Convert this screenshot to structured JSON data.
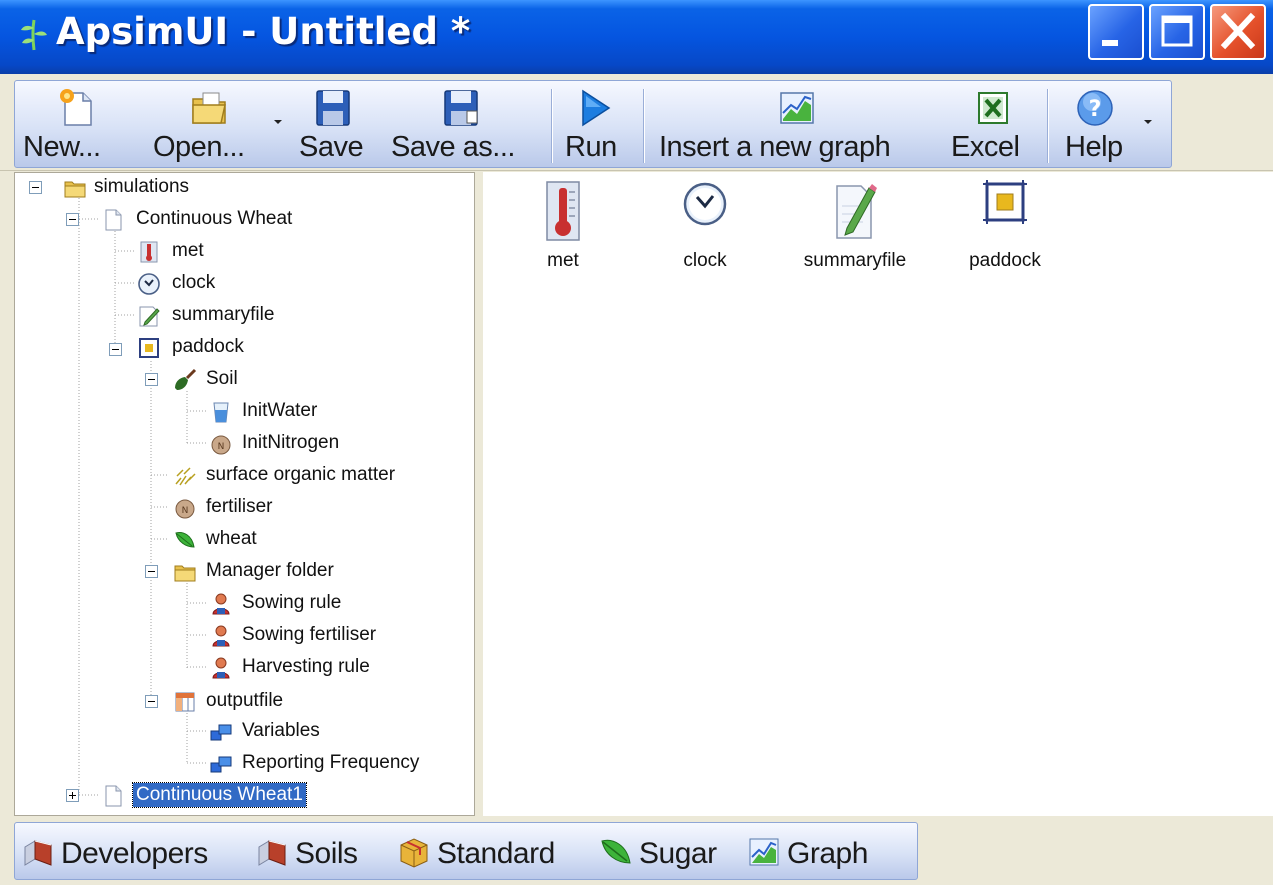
{
  "window": {
    "title": "ApsimUI - Untitled *"
  },
  "toolbar": {
    "new_label": "New...",
    "open_label": "Open...",
    "save_label": "Save",
    "save_as_label": "Save as...",
    "run_label": "Run",
    "insert_graph_label": "Insert a new graph",
    "excel_label": "Excel",
    "help_label": "Help"
  },
  "tree": {
    "simulations": "simulations",
    "continuous_wheat": "Continuous Wheat",
    "met": "met",
    "clock": "clock",
    "summaryfile": "summaryfile",
    "paddock": "paddock",
    "soil": "Soil",
    "initwater": "InitWater",
    "initnitrogen": "InitNitrogen",
    "surface_organic_matter": "surface organic matter",
    "fertiliser": "fertiliser",
    "wheat": "wheat",
    "manager_folder": "Manager folder",
    "sowing_rule": "Sowing rule",
    "sowing_fertiliser": "Sowing fertiliser",
    "harvesting_rule": "Harvesting rule",
    "outputfile": "outputfile",
    "variables": "Variables",
    "reporting_frequency": "Reporting Frequency",
    "continuous_wheat1": "Continuous Wheat1"
  },
  "content": {
    "items": [
      {
        "label": "met",
        "icon": "thermometer-icon"
      },
      {
        "label": "clock",
        "icon": "clock-icon"
      },
      {
        "label": "summaryfile",
        "icon": "document-pencil-icon"
      },
      {
        "label": "paddock",
        "icon": "paddock-icon"
      }
    ]
  },
  "tabs": {
    "developers": "Developers",
    "soils": "Soils",
    "standard": "Standard",
    "sugar": "Sugar",
    "graph": "Graph"
  },
  "colors": {
    "titlebar": "#0555e0",
    "selection": "#316ac5",
    "close_button": "#e5512b"
  }
}
